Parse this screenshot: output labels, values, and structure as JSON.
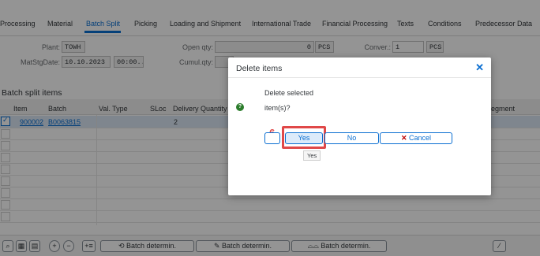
{
  "tabs": [
    "Processing",
    "Material",
    "Batch Split",
    "Picking",
    "Loading and Shipment",
    "International Trade",
    "Financial Processing",
    "Texts",
    "Conditions",
    "Predecessor Data"
  ],
  "active_tab": "Batch Split",
  "form": {
    "plant_label": "Plant:",
    "plant_value": "TOWH",
    "date_label": "MatStgDate:",
    "date_value": "10.10.2023",
    "time_value": "00:00...",
    "open_qty_label": "Open qty:",
    "open_qty_value": "0",
    "open_qty_unit": "PCS",
    "cumul_qty_label": "Cumul.qty:",
    "conver_label": "Conver.:",
    "conver_value": "1",
    "conver_unit": "PCS"
  },
  "table": {
    "title": "Batch split items",
    "columns": [
      "Item",
      "Batch",
      "Val. Type",
      "SLoc",
      "Delivery Quantity",
      "egment"
    ],
    "rows": [
      {
        "item": "900002",
        "batch": "B0063815",
        "qty": "2"
      }
    ]
  },
  "toolbar": {
    "batch_determ_1": "Batch determin.",
    "batch_determ_2": "Batch determin.",
    "batch_determ_3": "Batch determin."
  },
  "dialog": {
    "title": "Delete items",
    "close": "✕",
    "message_line1": "Delete selected",
    "message_line2": "item(s)?",
    "yes": "Yes",
    "no": "No",
    "cancel": "Cancel",
    "tooltip": "Yes",
    "step": "6"
  },
  "colors": {
    "accent": "#0a6ed1",
    "highlight": "#e04848",
    "question": "#2b7c2b"
  }
}
